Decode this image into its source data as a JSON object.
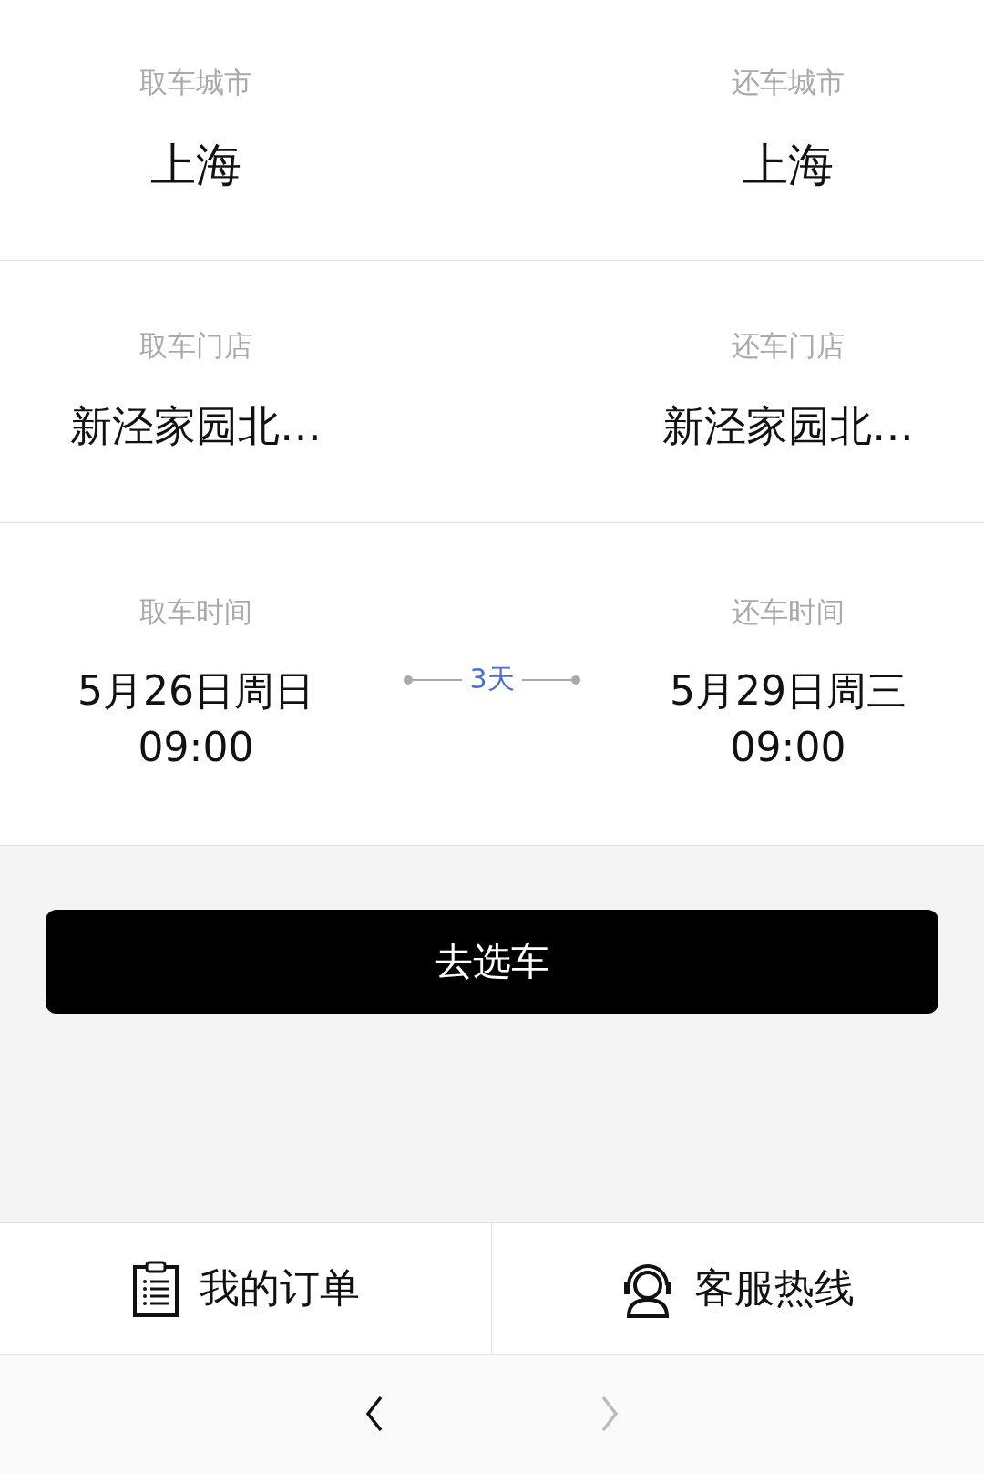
{
  "rows": [
    {
      "kind": "city",
      "left": {
        "label": "取车城市",
        "value": "上海"
      },
      "right": {
        "label": "还车城市",
        "value": "上海"
      }
    },
    {
      "kind": "store",
      "left": {
        "label": "取车门店",
        "value": "新泾家园北…"
      },
      "right": {
        "label": "还车门店",
        "value": "新泾家园北…"
      }
    },
    {
      "kind": "time",
      "left": {
        "label": "取车时间",
        "value": "5月26日周日",
        "time": "09:00"
      },
      "right": {
        "label": "还车时间",
        "value": "5月29日周三",
        "time": "09:00"
      },
      "duration": "3天"
    }
  ],
  "action_button": "去选车",
  "bottom_bar": [
    {
      "kind": "orders",
      "label": "我的订单"
    },
    {
      "kind": "service",
      "label": "客服热线"
    }
  ],
  "browser_nav": [
    {
      "kind": "back",
      "disabled": false
    },
    {
      "kind": "forward",
      "disabled": true
    }
  ]
}
